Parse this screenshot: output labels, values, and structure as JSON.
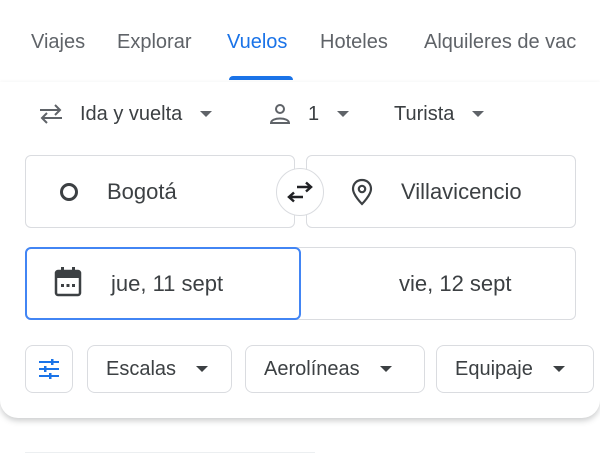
{
  "nav": {
    "tabs": [
      {
        "label": "Viajes",
        "active": false
      },
      {
        "label": "Explorar",
        "active": false
      },
      {
        "label": "Vuelos",
        "active": true
      },
      {
        "label": "Hoteles",
        "active": false
      },
      {
        "label": "Alquileres de vac",
        "active": false
      }
    ],
    "accent_color": "#1a73e8"
  },
  "search": {
    "trip_type": {
      "label": "Ida y vuelta",
      "icon": "swap-arrows-icon"
    },
    "passengers": {
      "label": "1",
      "icon": "person-icon"
    },
    "cabin_class": {
      "label": "Turista"
    },
    "origin": {
      "value": "Bogotá",
      "icon": "circle-icon"
    },
    "destination": {
      "value": "Villavicencio",
      "icon": "location-pin-icon"
    },
    "swap_icon": "swap-icon",
    "departure_date": {
      "value": "jue, 11 sept",
      "icon": "calendar-icon"
    },
    "return_date": {
      "value": "vie, 12 sept"
    },
    "focus_color": "#4285f4"
  },
  "filters": {
    "settings_icon": "tune-icon",
    "chips": [
      {
        "label": "Escalas"
      },
      {
        "label": "Aerolíneas"
      },
      {
        "label": "Equipaje"
      }
    ]
  }
}
